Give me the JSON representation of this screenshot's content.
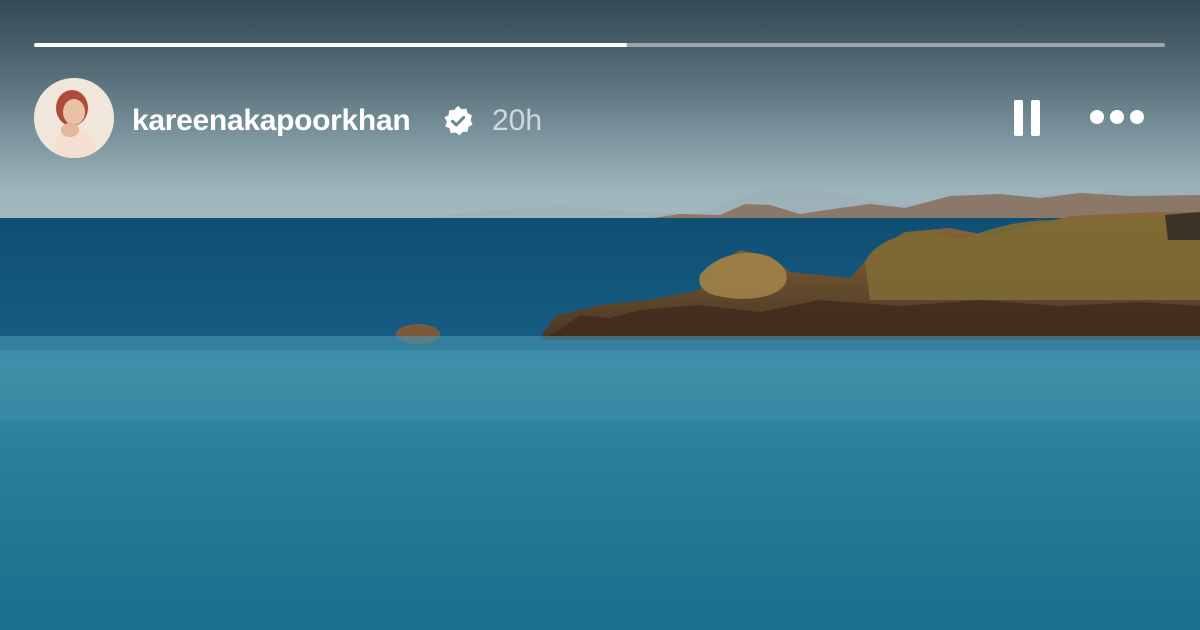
{
  "story": {
    "progress": 0.524,
    "user": {
      "username": "kareenakapoorkhan",
      "verified": true,
      "time_ago": "20h",
      "avatar_icon": "profile-photo"
    },
    "controls": {
      "pause_icon": "pause-icon",
      "more_icon": "more-options-icon"
    }
  },
  "colors": {
    "progress_fill": "#ffffff",
    "progress_track": "#ffffff73",
    "sea": "#1a6f8e",
    "sky": "#8fa9b2"
  }
}
